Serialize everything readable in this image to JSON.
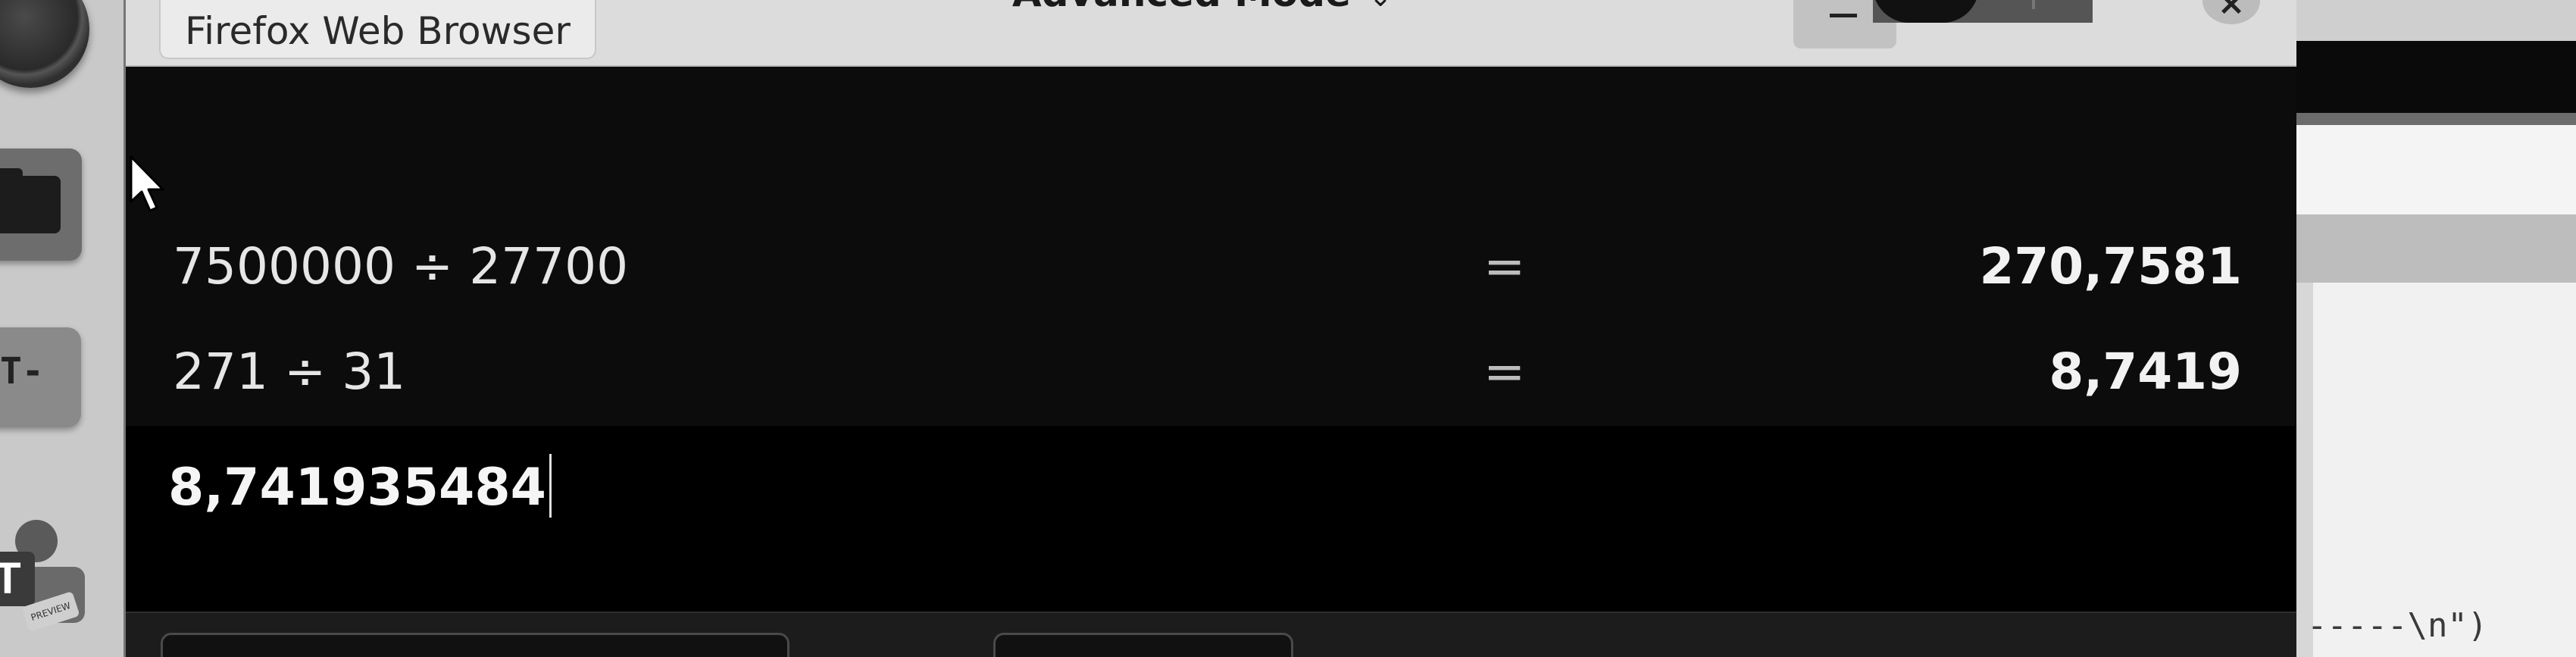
{
  "titlebar": {
    "tab_label": "Firefox Web Browser",
    "mode_title": "Advanced Mode",
    "mode_chevron": "⌄",
    "close_glyph": "×"
  },
  "calculator": {
    "history": [
      {
        "expression": "7500000 ÷ 27700",
        "equals": "=",
        "result": "270,7581"
      },
      {
        "expression": "271 ÷ 31",
        "equals": "=",
        "result": "8,7419"
      }
    ],
    "input_value": "8,741935484"
  },
  "dock": {
    "terminal_text": "T-",
    "teams_letter": "T",
    "teams_badge": "PREVIEW"
  },
  "background_window": {
    "code_text": "-----\\n\")"
  },
  "colors": {
    "calculator_bg": "#0c0c0c",
    "titlebar_bg": "#dcdcdc",
    "text_light": "#f2f2f2"
  },
  "icons": [
    "app-icon",
    "folder-icon",
    "terminal-icon",
    "teams-icon",
    "minimize-icon",
    "close-icon",
    "mouse-pointer-icon"
  ]
}
